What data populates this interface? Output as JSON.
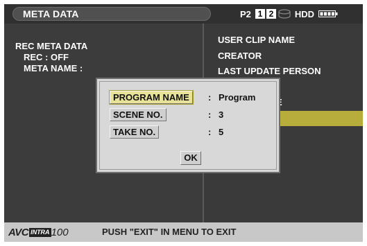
{
  "header": {
    "title": "META DATA",
    "slot_label": "P2",
    "slots": [
      "1",
      "2"
    ],
    "hdd_label": "HDD"
  },
  "left_pane": {
    "heading": "REC META DATA",
    "rec_status": "REC : OFF",
    "meta_name": "META NAME :"
  },
  "right_pane": {
    "items": [
      "USER CLIP NAME",
      "CREATOR",
      "LAST UPDATE PERSON"
    ],
    "partial_item_tail": "E"
  },
  "dialog": {
    "fields": [
      {
        "label": "PROGRAM NAME",
        "value": "Program",
        "selected": true
      },
      {
        "label": "SCENE NO.",
        "value": "3",
        "selected": false
      },
      {
        "label": "TAKE NO.",
        "value": "5",
        "selected": false
      }
    ],
    "separator": ":",
    "ok_label": "OK"
  },
  "footer": {
    "logo_avc": "AVC",
    "logo_intra": "INTRA",
    "logo_num": "100",
    "message": "PUSH \"EXIT\" IN MENU TO EXIT"
  },
  "colors": {
    "highlight": "#b6ad3c",
    "dialog_bg": "#d8d8d8",
    "screen_bg": "#3a3a3a"
  }
}
